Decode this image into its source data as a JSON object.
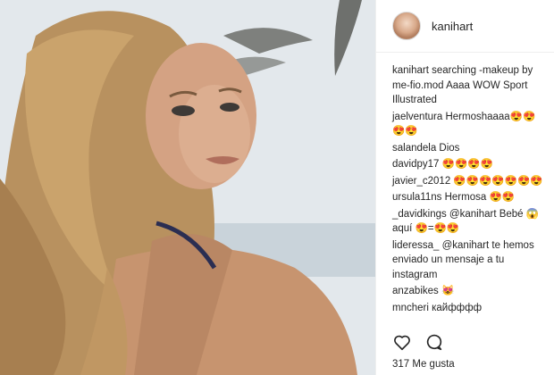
{
  "post": {
    "username": "kanihart",
    "likes": "317 Me gusta",
    "image_label": "photo"
  },
  "comments": [
    {
      "user": "kanihart",
      "text": " searching -makeup by me-fio.mod Aaaa WOW Sport Illustrated"
    },
    {
      "user": "jaelventura",
      "text": " Hermoshaaaa😍😍😍😍"
    },
    {
      "user": "salandela",
      "text": " Dios"
    },
    {
      "user": "davidpy17",
      "text": " 😍😍😍😍"
    },
    {
      "user": "javier_c2012",
      "text": " 😍😍😍😍😍😍😍"
    },
    {
      "user": "ursula11ns",
      "text": " Hermosa 😍😍"
    },
    {
      "user": "_davidkings",
      "text": " @kanihart Bebé 😱 aquí 😍=😍😍"
    },
    {
      "user": "lideressa_",
      "text": " @kanihart te hemos enviado un mensaje a tu instagram"
    },
    {
      "user": "anzabikes",
      "text": " 😻"
    },
    {
      "user": "mncheri",
      "text": " кайфффф"
    }
  ],
  "icons": {
    "like": "heart-icon",
    "comment": "comment-icon"
  }
}
